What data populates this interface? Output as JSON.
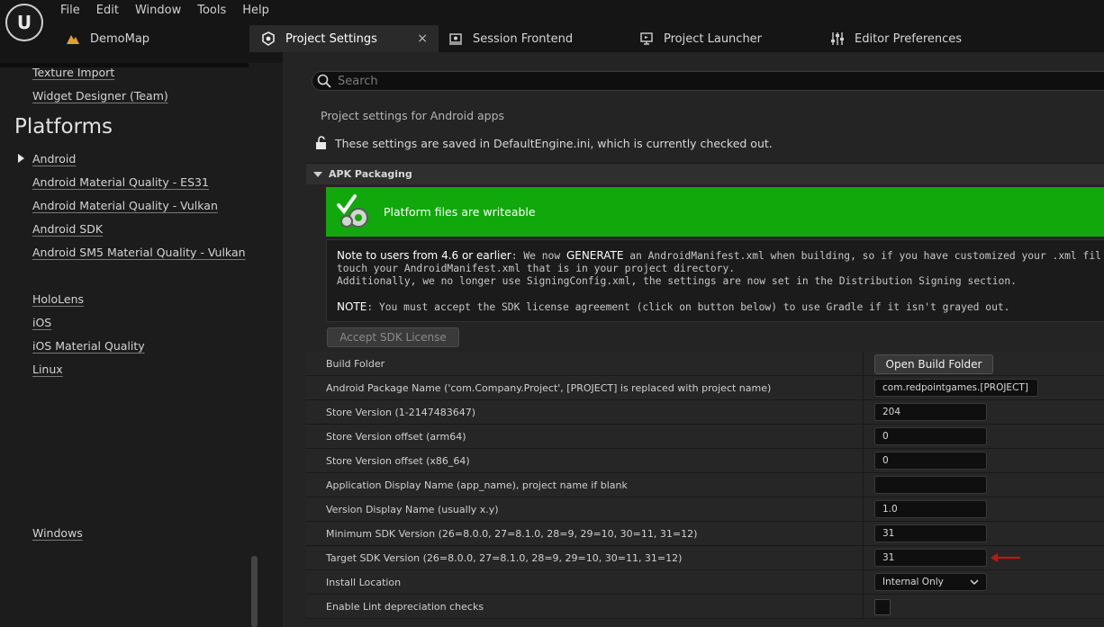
{
  "app": {
    "logo": "U",
    "menu": [
      "File",
      "Edit",
      "Window",
      "Tools",
      "Help"
    ]
  },
  "tabs": [
    {
      "label": "DemoMap",
      "icon": "level-icon"
    },
    {
      "label": "Project Settings",
      "icon": "settings-cube-icon",
      "active": true,
      "close": "×"
    },
    {
      "label": "Session Frontend",
      "icon": "session-icon"
    },
    {
      "label": "Project Launcher",
      "icon": "launcher-icon"
    },
    {
      "label": "Editor Preferences",
      "icon": "sliders-icon"
    }
  ],
  "sidebar": {
    "top_links": [
      "Texture Import",
      "Widget Designer (Team)"
    ],
    "heading": "Platforms",
    "platform_links": [
      "Android",
      "Android Material Quality - ES31",
      "Android Material Quality - Vulkan",
      "Android SDK",
      "Android SM5 Material Quality - Vulkan",
      "HoloLens",
      "iOS",
      "iOS Material Quality",
      "Linux",
      "Windows"
    ]
  },
  "main": {
    "search_placeholder": "Search",
    "description": "Project settings for Android apps",
    "saved_note": "These settings are saved in DefaultEngine.ini, which is currently checked out.",
    "section_title": "APK Packaging",
    "banner_text": "Platform files are writeable",
    "note": {
      "l1_bold": "Note to users from 4.6 or earlier",
      "l1_a": ": We now ",
      "l1_bold2": "GENERATE",
      "l1_b": " an AndroidManifest.xml when building, so if you have customized your .xml fil",
      "l2": "touch your AndroidManifest.xml that is in your project directory.",
      "l3": "Additionally, we no longer use SigningConfig.xml, the settings are now set in the Distribution Signing section.",
      "l4_bold": "NOTE",
      "l4": ": You must accept the SDK license agreement (click on button below) to use Gradle if it isn't grayed out."
    },
    "accept_button": "Accept SDK License",
    "rows": [
      {
        "label": "Build Folder",
        "button": "Open Build Folder"
      },
      {
        "label": "Android Package Name ('com.Company.Project', [PROJECT] is replaced with project name)",
        "value": "com.redpointgames.[PROJECT]"
      },
      {
        "label": "Store Version (1-2147483647)",
        "value": "204"
      },
      {
        "label": "Store Version offset (arm64)",
        "value": "0"
      },
      {
        "label": "Store Version offset (x86_64)",
        "value": "0"
      },
      {
        "label": "Application Display Name (app_name), project name if blank",
        "value": ""
      },
      {
        "label": "Version Display Name (usually x.y)",
        "value": "1.0"
      },
      {
        "label": "Minimum SDK Version (26=8.0.0, 27=8.1.0, 28=9, 29=10, 30=11, 31=12)",
        "value": "31"
      },
      {
        "label": "Target SDK Version (26=8.0.0, 27=8.1.0, 28=9, 29=10, 30=11, 31=12)",
        "value": "31"
      },
      {
        "label": "Install Location",
        "dropdown": "Internal Only"
      },
      {
        "label": "Enable Lint depreciation checks",
        "checkbox": false
      }
    ],
    "highlight_color": "#cc1111"
  }
}
